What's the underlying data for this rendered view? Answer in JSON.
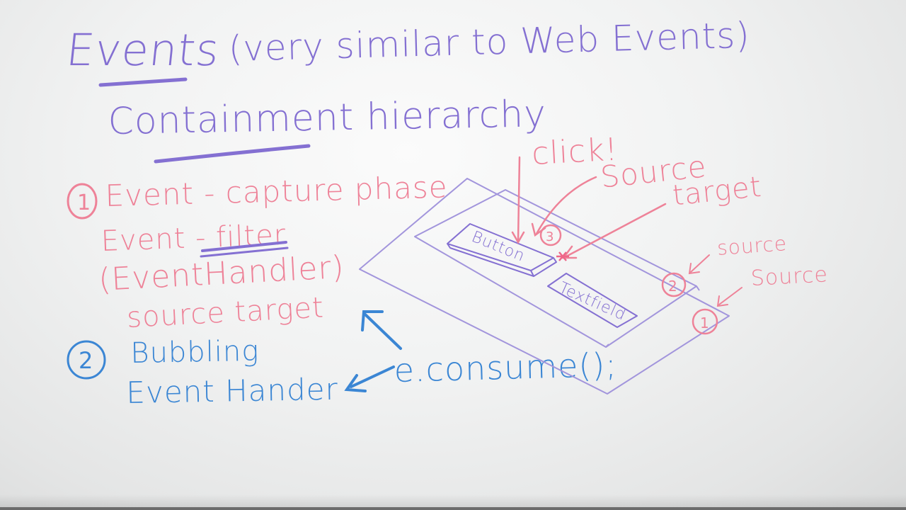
{
  "board": {
    "title": "Events",
    "title_note": "(very similar to Web Events)",
    "subtitle": "Containment hierarchy",
    "phase1": {
      "number": "1",
      "title": "Event - capture phase",
      "filter_line": "Event - filter",
      "handler_line": "(EventHandler)",
      "source_target": "source target"
    },
    "phase2": {
      "number": "2",
      "title": "Bubbling",
      "handler": "Event Hander"
    },
    "consume_call": "e.consume();",
    "diagram": {
      "click_label": "click!",
      "source_label_top": "Source",
      "target_label": "target",
      "source_label_2": "source",
      "source_label_1": "Source",
      "button_label": "Button",
      "textfield_label": "Textfield",
      "badge_3": "3",
      "badge_2": "2",
      "badge_1": "1"
    }
  },
  "colors": {
    "purple_marker": "#8470d2",
    "pink_marker": "#ee8298",
    "blue_marker": "#3b86d4",
    "board_white": "#f4f5f5"
  }
}
